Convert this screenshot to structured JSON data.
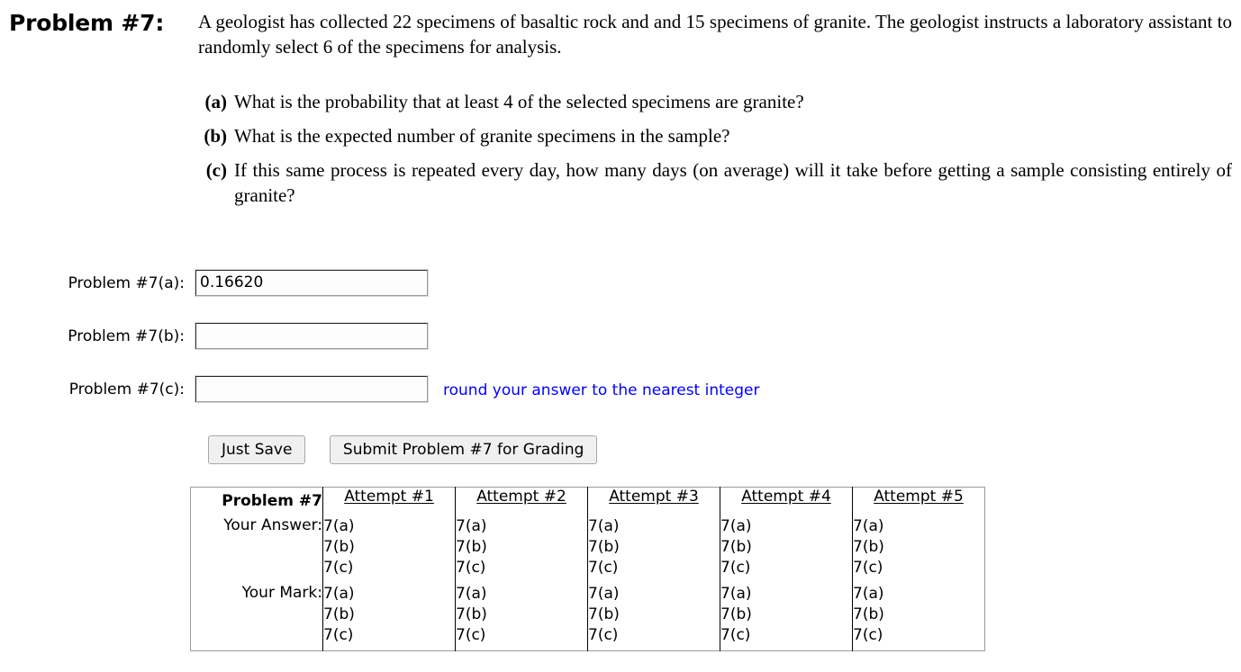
{
  "problem": {
    "number_label": "Problem #7:",
    "statement": "A geologist has collected 22 specimens of basaltic rock and and 15 specimens of granite. The geologist instructs a laboratory assistant to randomly select 6 of the specimens for analysis.",
    "parts": [
      {
        "label": "(a)",
        "text": "What is the probability that at least 4 of the selected specimens are granite?"
      },
      {
        "label": "(b)",
        "text": "What is the expected number of granite specimens in the sample?"
      },
      {
        "label": "(c)",
        "text": "If this same process is repeated every day, how many days (on average) will it take before getting a sample consisting entirely of granite?"
      }
    ]
  },
  "answers": [
    {
      "label": "Problem #7(a):",
      "value": "0.16620",
      "placeholder": "",
      "hint": ""
    },
    {
      "label": "Problem #7(b):",
      "value": "",
      "placeholder": "",
      "hint": ""
    },
    {
      "label": "Problem #7(c):",
      "value": "",
      "placeholder": "",
      "hint": "round your answer to the nearest integer"
    }
  ],
  "buttons": {
    "just_save": "Just Save",
    "submit": "Submit Problem #7 for Grading"
  },
  "results": {
    "corner_label": "Problem #7",
    "attempt_headers": [
      "Attempt #1",
      "Attempt #2",
      "Attempt #3",
      "Attempt #4",
      "Attempt #5"
    ],
    "rows": [
      {
        "label": "Your Answer:",
        "cells": [
          [
            "7(a)",
            "7(b)",
            "7(c)"
          ],
          [
            "7(a)",
            "7(b)",
            "7(c)"
          ],
          [
            "7(a)",
            "7(b)",
            "7(c)"
          ],
          [
            "7(a)",
            "7(b)",
            "7(c)"
          ],
          [
            "7(a)",
            "7(b)",
            "7(c)"
          ]
        ]
      },
      {
        "label": "Your Mark:",
        "cells": [
          [
            "7(a)",
            "7(b)",
            "7(c)"
          ],
          [
            "7(a)",
            "7(b)",
            "7(c)"
          ],
          [
            "7(a)",
            "7(b)",
            "7(c)"
          ],
          [
            "7(a)",
            "7(b)",
            "7(c)"
          ],
          [
            "7(a)",
            "7(b)",
            "7(c)"
          ]
        ]
      }
    ]
  },
  "colors": {
    "hint_blue": "#0000FF",
    "button_face": "#F0F0F0",
    "table_border": "#9B9B9B"
  }
}
